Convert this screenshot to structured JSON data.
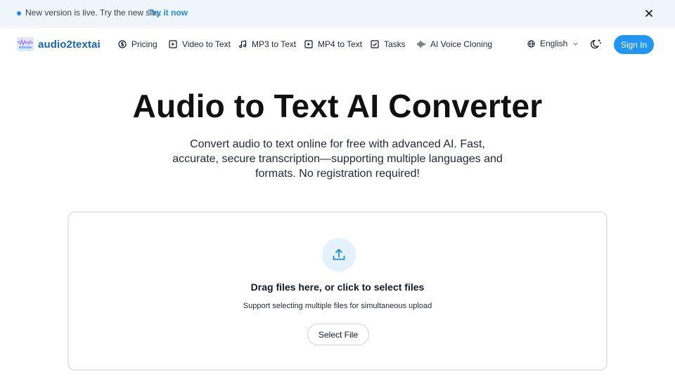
{
  "banner": {
    "message": "New version is live. Try the new site.",
    "link_label": "Try it now"
  },
  "header": {
    "logo_text": "audio2textai",
    "nav": [
      {
        "label": "Pricing",
        "icon": "dollar-circle-icon"
      },
      {
        "label": "Video to Text",
        "icon": "play-square-icon"
      },
      {
        "label": "MP3 to Text",
        "icon": "music-note-icon"
      },
      {
        "label": "MP4 to Text",
        "icon": "play-square-icon"
      },
      {
        "label": "Tasks",
        "icon": "checkbox-icon"
      },
      {
        "label": "AI Voice Cloning",
        "icon": "waveform-icon"
      }
    ],
    "language": "English",
    "signin_label": "Sign In"
  },
  "hero": {
    "title": "Audio to Text AI Converter",
    "subtitle": "Convert audio to text online for free with advanced AI. Fast, accurate, secure transcription—supporting multiple languages and formats. No registration required!"
  },
  "upload": {
    "title": "Drag files here, or click to select files",
    "subtitle": "Support selecting multiple files for simultaneous upload",
    "button_label": "Select File"
  },
  "colors": {
    "accent": "#2196f3",
    "banner_bg": "#eef6fc",
    "logo_text": "#1565c0"
  }
}
